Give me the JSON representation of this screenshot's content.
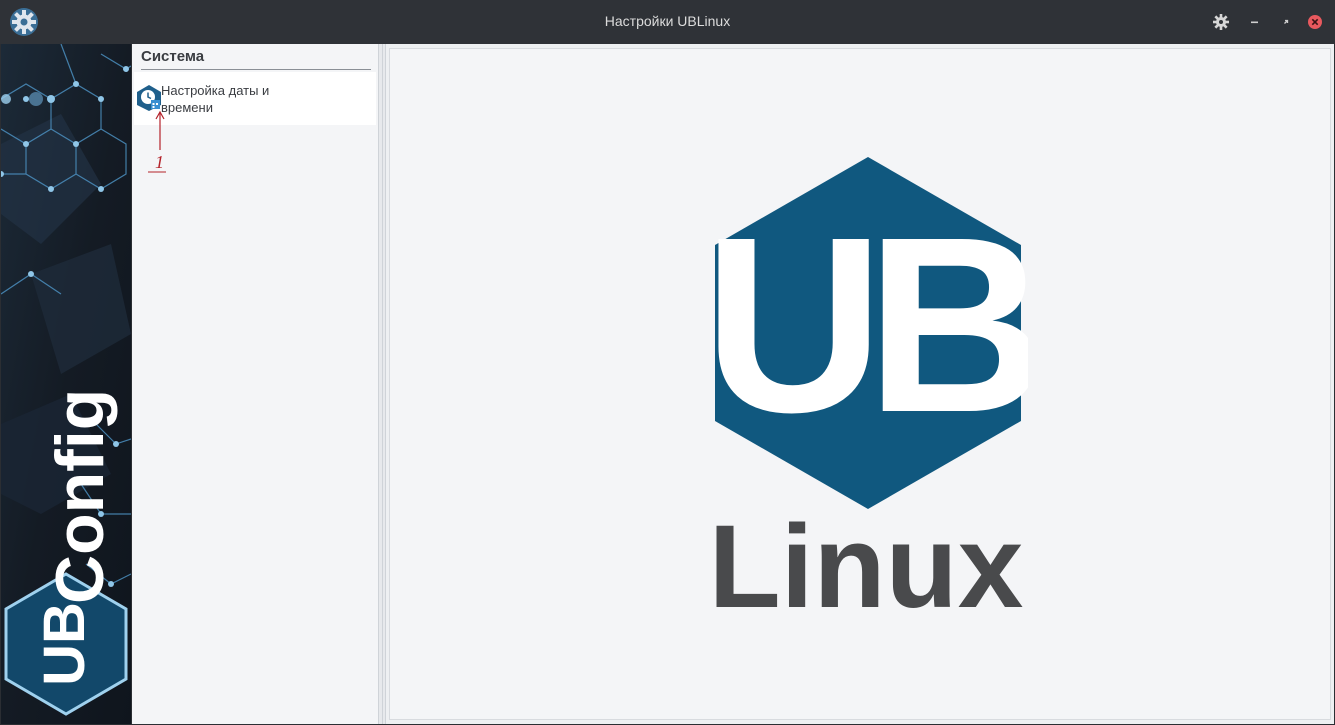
{
  "window": {
    "title": "Настройки UBLinux",
    "icons": [
      "app-gear-icon",
      "settings-gear-icon",
      "minimize-icon",
      "restore-icon",
      "close-icon"
    ]
  },
  "banner": {
    "logo_text": "UB",
    "wordmark": "Config"
  },
  "category": {
    "header": "Система",
    "items": [
      {
        "label": "Настройка даты и времени",
        "icon": "clock-calendar-icon"
      }
    ]
  },
  "annotation": {
    "label": "1"
  },
  "main": {
    "logo_letters": "UB",
    "logo_word": "Linux"
  },
  "colors": {
    "titlebar": "#2f3237",
    "brand_blue": "#10587f",
    "logo_text_gray": "#494a4c",
    "close_red": "#e8595e",
    "annotation_red": "#b4222a"
  }
}
